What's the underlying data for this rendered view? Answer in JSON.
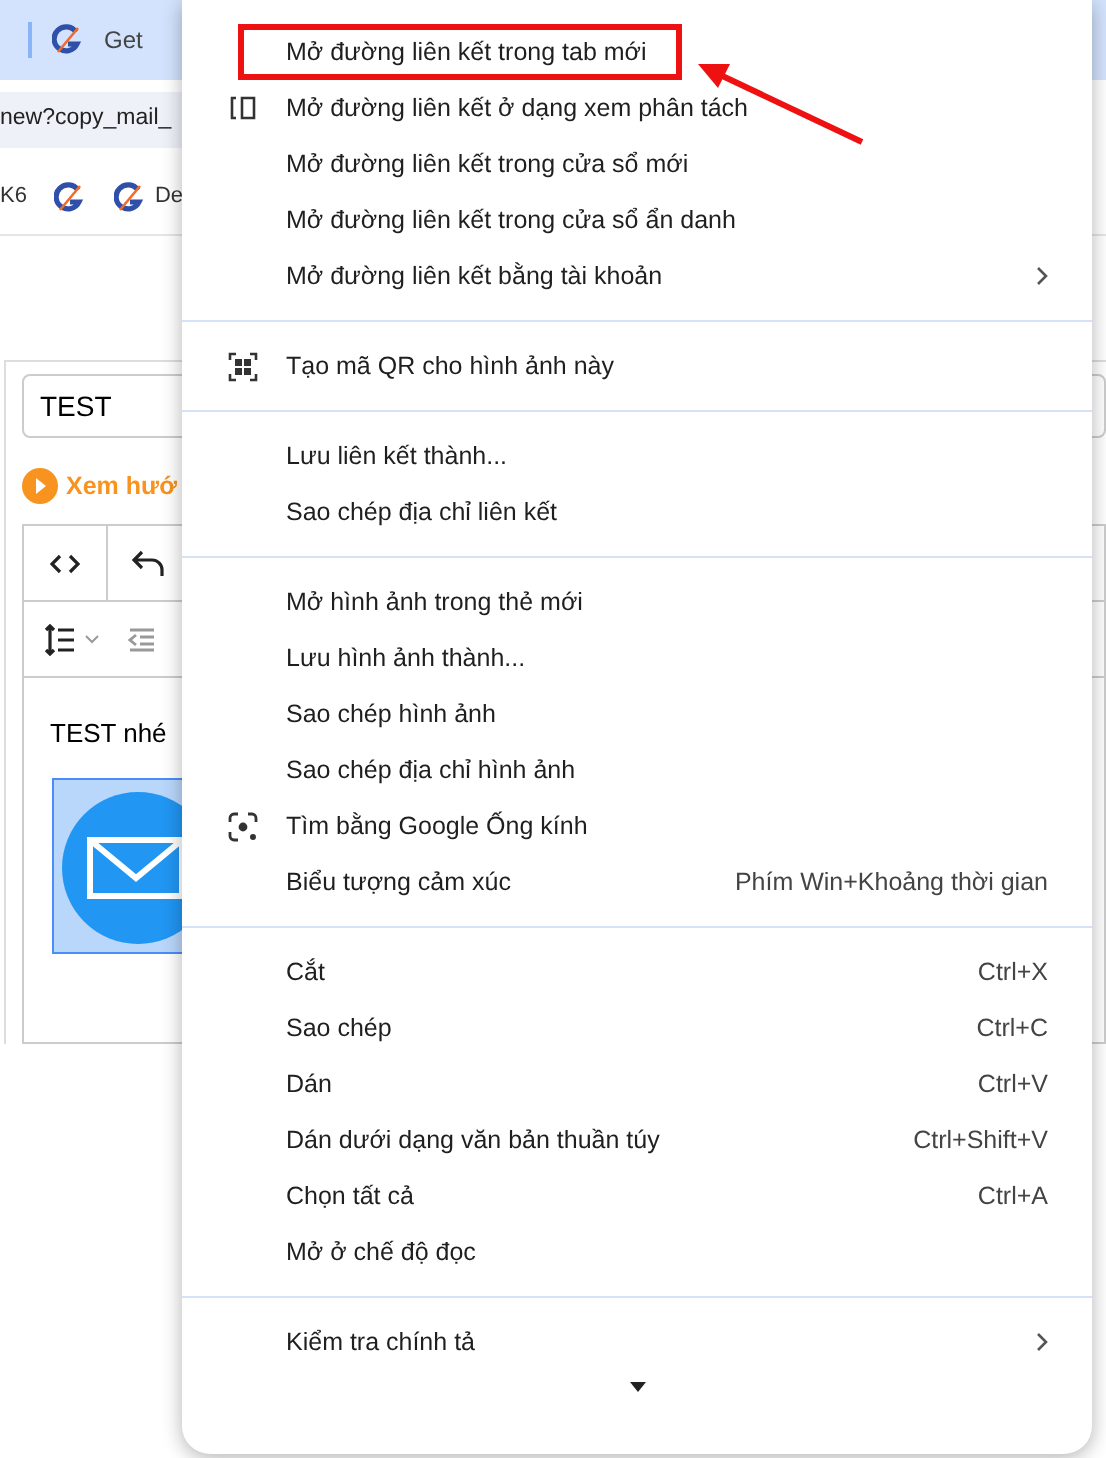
{
  "browser": {
    "tab": {
      "title": "Get"
    },
    "address": "new?copy_mail_",
    "bookmarks": [
      {
        "kind": "text",
        "label": "K6"
      },
      {
        "kind": "logo"
      },
      {
        "kind": "logo_text",
        "label": "De"
      }
    ]
  },
  "page": {
    "subject_field": {
      "value": "TEST"
    },
    "guide_link": "Xem hướ",
    "editor": {
      "body_text": "TEST nhé",
      "image_selected": true
    }
  },
  "menu": {
    "groups": [
      {
        "items": [
          {
            "kind": "plain",
            "label": "Mở đường liên kết trong tab mới",
            "annotated": true
          },
          {
            "kind": "split_view",
            "label": "Mở đường liên kết ở dạng xem phân tách",
            "annotated": false
          },
          {
            "kind": "plain",
            "label": "Mở đường liên kết trong cửa sổ mới",
            "annotated": false
          },
          {
            "kind": "plain",
            "label": "Mở đường liên kết trong cửa sổ ẩn danh",
            "annotated": false
          },
          {
            "kind": "submenu",
            "label": "Mở đường liên kết bằng tài khoản",
            "annotated": false
          }
        ]
      },
      {
        "items": [
          {
            "kind": "qr",
            "label": "Tạo mã QR cho hình ảnh này",
            "annotated": false
          }
        ]
      },
      {
        "items": [
          {
            "kind": "plain",
            "label": "Lưu liên kết thành...",
            "annotated": false
          },
          {
            "kind": "plain",
            "label": "Sao chép địa chỉ liên kết",
            "annotated": false
          }
        ]
      },
      {
        "items": [
          {
            "kind": "plain",
            "label": "Mở hình ảnh trong thẻ mới",
            "annotated": false
          },
          {
            "kind": "plain",
            "label": "Lưu hình ảnh thành...",
            "annotated": false
          },
          {
            "kind": "plain",
            "label": "Sao chép hình ảnh",
            "annotated": false
          },
          {
            "kind": "plain",
            "label": "Sao chép địa chỉ hình ảnh",
            "annotated": false
          },
          {
            "kind": "lens",
            "label": "Tìm bằng Google Ống kính",
            "annotated": false
          },
          {
            "kind": "plain",
            "label": "Biểu tượng cảm xúc",
            "shortcut": "Phím Win+Khoảng thời gian",
            "annotated": false
          }
        ]
      },
      {
        "items": [
          {
            "kind": "plain",
            "label": "Cắt",
            "shortcut": "Ctrl+X",
            "annotated": false
          },
          {
            "kind": "plain",
            "label": "Sao chép",
            "shortcut": "Ctrl+C",
            "annotated": false
          },
          {
            "kind": "plain",
            "label": "Dán",
            "shortcut": "Ctrl+V",
            "annotated": false
          },
          {
            "kind": "plain",
            "label": "Dán dưới dạng văn bản thuần túy",
            "shortcut": "Ctrl+Shift+V",
            "annotated": false
          },
          {
            "kind": "plain",
            "label": "Chọn tất cả",
            "shortcut": "Ctrl+A",
            "annotated": false
          },
          {
            "kind": "plain",
            "label": "Mở ở chế độ đọc",
            "annotated": false
          }
        ]
      },
      {
        "items": [
          {
            "kind": "submenu",
            "label": "Kiểm tra chính tả",
            "annotated": false
          }
        ]
      }
    ]
  }
}
